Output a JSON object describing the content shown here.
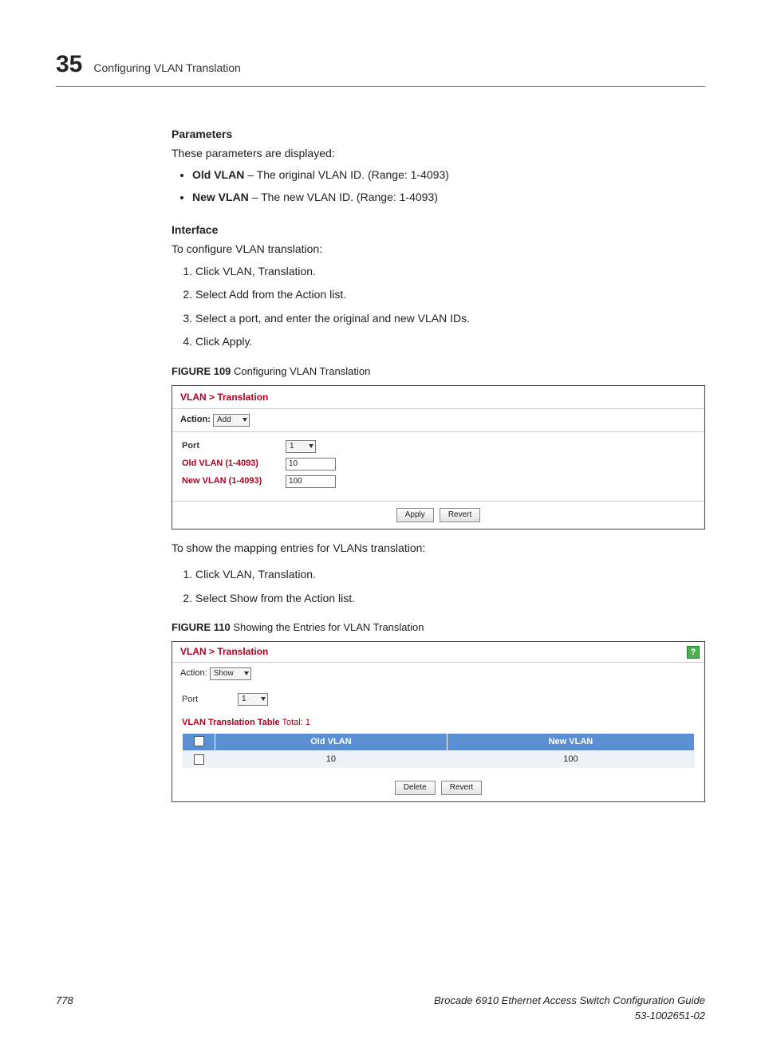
{
  "header": {
    "chapter_number": "35",
    "chapter_title": "Configuring VLAN Translation"
  },
  "sections": {
    "parameters_heading": "Parameters",
    "parameters_intro": "These parameters are displayed:",
    "params": [
      {
        "term": "Old VLAN",
        "desc": " – The original VLAN ID. (Range: 1-4093)"
      },
      {
        "term": "New VLAN",
        "desc": " – The new VLAN ID. (Range: 1-4093)"
      }
    ],
    "interface_heading": "Interface",
    "interface_intro": "To configure VLAN translation:",
    "steps1": [
      "Click VLAN, Translation.",
      "Select Add from the Action list.",
      "Select a port, and enter the original and new VLAN IDs.",
      "Click Apply."
    ],
    "fig109_label": "FIGURE 109",
    "fig109_title": "  Configuring VLAN Translation",
    "between_text": "To show the mapping entries for VLANs translation:",
    "steps2": [
      "Click VLAN, Translation.",
      "Select Show from the Action list."
    ],
    "fig110_label": "FIGURE 110",
    "fig110_title": "  Showing the Entries for VLAN Translation"
  },
  "fig109": {
    "breadcrumb": "VLAN > Translation",
    "action_label": "Action:",
    "action_value": "Add",
    "port_label": "Port",
    "port_value": "1",
    "old_vlan_label": "Old VLAN (1-4093)",
    "old_vlan_value": "10",
    "new_vlan_label": "New VLAN (1-4093)",
    "new_vlan_value": "100",
    "apply_btn": "Apply",
    "revert_btn": "Revert"
  },
  "fig110": {
    "breadcrumb": "VLAN > Translation",
    "help": "?",
    "action_label": "Action:",
    "action_value": "Show",
    "port_label": "Port",
    "port_value": "1",
    "table_title": "VLAN Translation Table",
    "total_label": "  Total: ",
    "total_value": "1",
    "col_old": "Old VLAN",
    "col_new": "New VLAN",
    "rows": [
      {
        "old": "10",
        "new": "100"
      }
    ],
    "delete_btn": "Delete",
    "revert_btn": "Revert"
  },
  "footer": {
    "page_num": "778",
    "guide_title": "Brocade 6910 Ethernet Access Switch Configuration Guide",
    "doc_num": "53-1002651-02"
  }
}
